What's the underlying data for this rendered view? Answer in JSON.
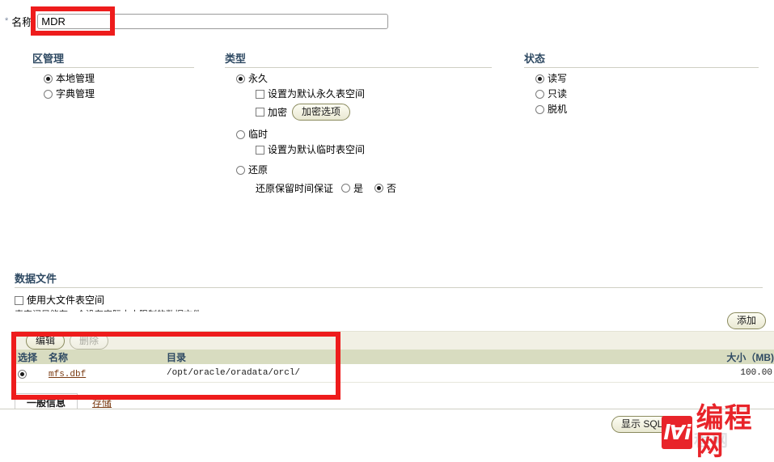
{
  "form": {
    "required_marker": "*",
    "name_label": "名称",
    "name_value": "MDR",
    "name_placeholder": ""
  },
  "extent": {
    "heading": "区管理",
    "options": [
      {
        "label": "本地管理",
        "selected": true
      },
      {
        "label": "字典管理",
        "selected": false
      }
    ]
  },
  "type": {
    "heading": "类型",
    "permanent": {
      "label": "永久",
      "selected": true
    },
    "default_permanent": {
      "label": "设置为默认永久表空间",
      "checked": false
    },
    "encrypt": {
      "label": "加密",
      "checked": false
    },
    "encrypt_options_button": "加密选项",
    "temporary": {
      "label": "临时",
      "selected": false
    },
    "default_temporary": {
      "label": "设置为默认临时表空间",
      "checked": false
    },
    "undo": {
      "label": "还原",
      "selected": false
    },
    "undo_retention": {
      "label": "还原保留时间保证",
      "yes": "是",
      "no": "否",
      "value": "否"
    }
  },
  "status": {
    "heading": "状态",
    "options": [
      {
        "label": "读写",
        "selected": true
      },
      {
        "label": "只读",
        "selected": false
      },
      {
        "label": "脱机",
        "selected": false
      }
    ]
  },
  "datafiles": {
    "heading": "数据文件",
    "bigfile": {
      "label": "使用大文件表空间",
      "checked": false
    },
    "note": "表空间只能有一个没有实际大小限制的数据文件。",
    "add_button": "添加",
    "edit_button": "编辑",
    "delete_button": "删除",
    "columns": {
      "select": "选择",
      "name": "名称",
      "directory": "目录",
      "size": "大小（MB)"
    },
    "rows": [
      {
        "selected": true,
        "name": "mfs.dbf",
        "directory": "/opt/oracle/oradata/orcl/",
        "size": "100.00"
      }
    ]
  },
  "tabs": [
    {
      "label": "一般信息",
      "active": true
    },
    {
      "label": "存储",
      "active": false
    }
  ],
  "footer": {
    "show_sql_button": "显示 SQL"
  },
  "watermark": {
    "mark": "lⱯi",
    "text": "编程网"
  },
  "colors": {
    "heading": "#2f4a63",
    "table_header_bg": "#d8dcc0",
    "toolbar_bg": "#f1f0e4",
    "link": "#7a3b12",
    "annotation": "#ee1c1c",
    "watermark": "#e8242a"
  }
}
